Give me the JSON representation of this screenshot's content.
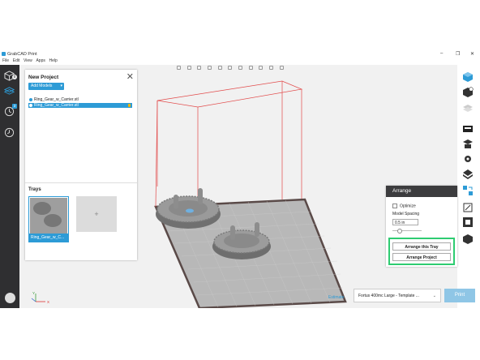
{
  "app": {
    "title": "GrabCAD Print"
  },
  "window_controls": {
    "minimize": "–",
    "restore": "❐",
    "close": "✕"
  },
  "menu": [
    "File",
    "Edit",
    "View",
    "Apps",
    "Help"
  ],
  "left_sidebar": {
    "icons": [
      "cube-icon",
      "tray-icon",
      "history-icon",
      "recent-icon",
      "user-avatar-icon"
    ],
    "badges": {
      "models": "0",
      "history": "3"
    }
  },
  "project_panel": {
    "title": "New Project",
    "add_models_label": "Add Models",
    "add_models_caret": "▾",
    "close_glyph": "✕",
    "models": [
      {
        "name": "Ring_Gear_w_Carrier.stl",
        "selected": false
      },
      {
        "name": "Ring_Gear_w_Carrier.stl",
        "selected": true,
        "warning": true
      }
    ],
    "trays_label": "Trays",
    "trays": [
      {
        "label": "Ring_Gear_w_C..."
      }
    ],
    "add_tray_glyph": "+"
  },
  "arrange_panel": {
    "title": "Arrange",
    "optimize_label": "Optimize",
    "spacing_label": "Model Spacing",
    "spacing_value": "0.5 in",
    "arrange_tray_button": "Arrange this Tray",
    "arrange_project_button": "Arrange Project"
  },
  "bottom_bar": {
    "estimate_link": "Estimate",
    "printer": "Fortus 400mc Large - Template ...",
    "printer_chevron": "⌄",
    "print_button": "Print"
  },
  "axis": {
    "x_label": "X",
    "y_label": "Y"
  },
  "colors": {
    "accent": "#2d9bd6",
    "highlight": "#2ecc71",
    "dark_sidebar": "#2f2f31",
    "bounding_box": "#e24a4a",
    "bed": "#b8b8b8",
    "bed_border": "#5a4a48",
    "model": "#8d8d8d"
  }
}
